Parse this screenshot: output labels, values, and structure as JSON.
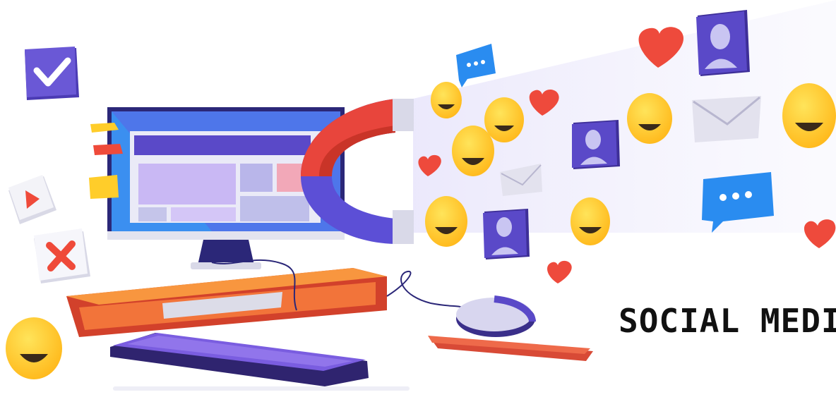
{
  "illustration": {
    "caption": "SOCIAL MEDIA",
    "icons": [
      "checkmark-icon",
      "play-icon",
      "cross-icon",
      "magnet-icon",
      "smiley-face-icon",
      "heart-icon",
      "envelope-icon",
      "chat-bubble-icon",
      "profile-card-icon",
      "computer-monitor-icon",
      "keyboard-icon",
      "mouse-icon"
    ],
    "colors": {
      "magnet_red": "#e8453c",
      "magnet_blue": "#5c4fd6",
      "smiley_yellow": "#ffd21f",
      "heart_red": "#ee4a3c",
      "card_purple": "#5a49c8",
      "bubble_blue": "#2a8cf0",
      "desk_orange": "#f2743a",
      "screen_blue": "#3b8ff0"
    }
  }
}
